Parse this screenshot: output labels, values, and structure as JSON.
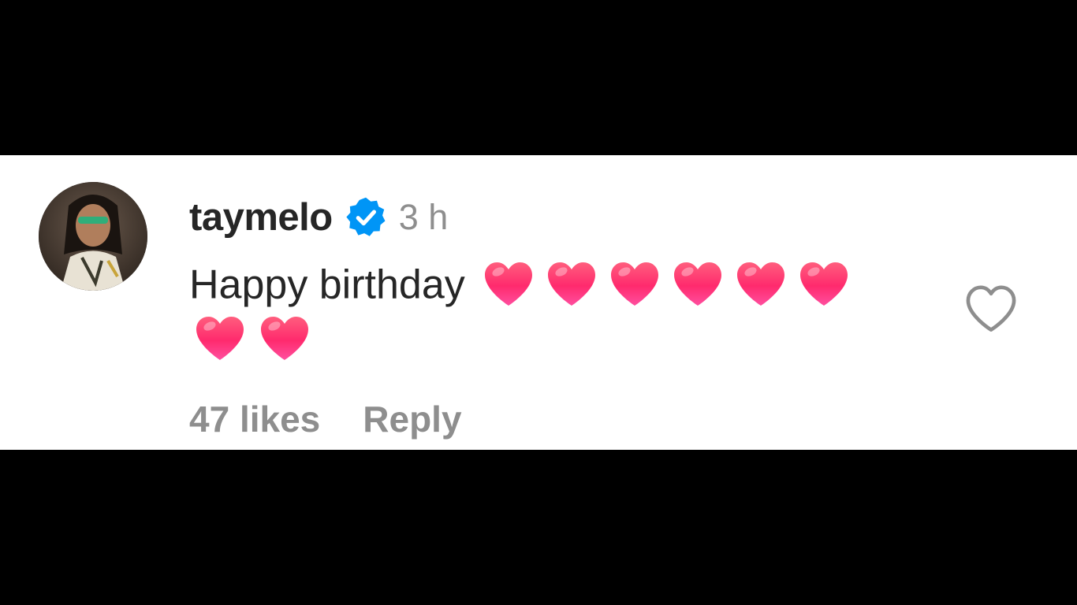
{
  "comment": {
    "username": "taymelo",
    "verified": true,
    "timestamp": "3 h",
    "text": "Happy birthday",
    "emoji": "heart",
    "emoji_count": 8,
    "likes_label": "47 likes",
    "reply_label": "Reply",
    "avatar": "profile-photo"
  },
  "colors": {
    "verified_blue": "#0095f6",
    "text_primary": "#262626",
    "text_secondary": "#8e8e8e",
    "heart_pink": "#ff2a6d",
    "background": "#ffffff",
    "letterbox": "#000000"
  },
  "icons": {
    "verified": "verified-badge-icon",
    "like": "heart-outline-icon",
    "emoji": "pink-heart-emoji"
  }
}
